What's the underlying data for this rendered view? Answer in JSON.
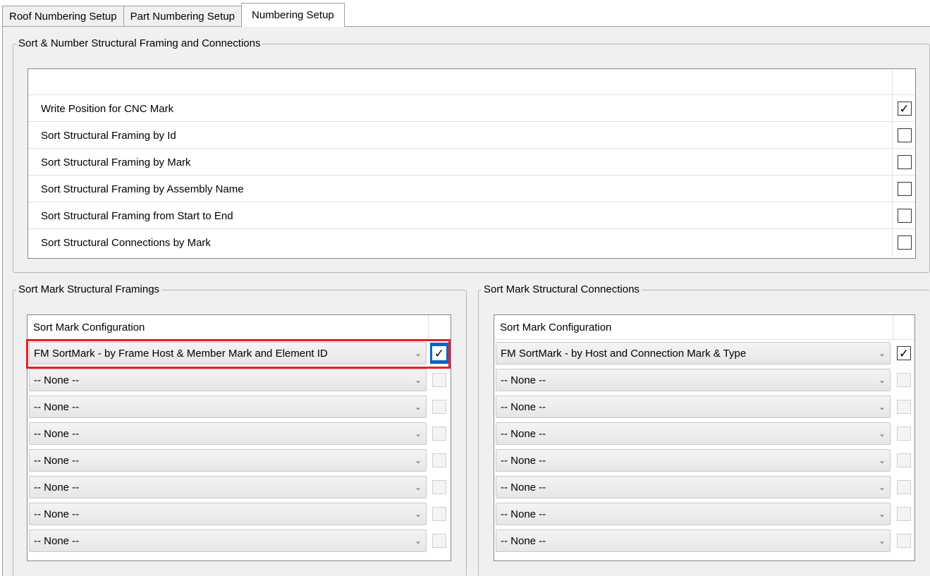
{
  "tabs": [
    "Roof Numbering Setup",
    "Part Numbering Setup",
    "Numbering Setup"
  ],
  "active_tab": 2,
  "sort_number_group": {
    "title": "Sort & Number Structural Framing and Connections",
    "options": [
      {
        "label": "Write Position for CNC Mark",
        "checked": true,
        "mark": "✓"
      },
      {
        "label": "Sort Structural Framing by Id",
        "checked": false,
        "mark": ""
      },
      {
        "label": "Sort Structural Framing by Mark",
        "checked": false,
        "mark": ""
      },
      {
        "label": "Sort Structural Framing by Assembly Name",
        "checked": false,
        "mark": ""
      },
      {
        "label": "Sort Structural Framing from Start to End",
        "checked": false,
        "mark": ""
      },
      {
        "label": "Sort Structural Connections by Mark",
        "checked": false,
        "mark": ""
      }
    ]
  },
  "framings_group": {
    "title": "Sort Mark Structural Framings",
    "column_header": "Sort Mark Configuration",
    "rows": [
      {
        "value": "FM SortMark - by Frame Host & Member Mark and Element ID",
        "checked": true,
        "mark": "✓"
      },
      {
        "value": "-- None --",
        "checked": false,
        "mark": ""
      },
      {
        "value": "-- None --",
        "checked": false,
        "mark": ""
      },
      {
        "value": "-- None --",
        "checked": false,
        "mark": ""
      },
      {
        "value": "-- None --",
        "checked": false,
        "mark": ""
      },
      {
        "value": "-- None --",
        "checked": false,
        "mark": ""
      },
      {
        "value": "-- None --",
        "checked": false,
        "mark": ""
      },
      {
        "value": "-- None --",
        "checked": false,
        "mark": ""
      }
    ]
  },
  "connections_group": {
    "title": "Sort Mark Structural Connections",
    "column_header": "Sort Mark Configuration",
    "rows": [
      {
        "value": "FM SortMark - by Host and Connection Mark & Type",
        "checked": true,
        "mark": "✓"
      },
      {
        "value": "-- None --",
        "checked": false,
        "mark": ""
      },
      {
        "value": "-- None --",
        "checked": false,
        "mark": ""
      },
      {
        "value": "-- None --",
        "checked": false,
        "mark": ""
      },
      {
        "value": "-- None --",
        "checked": false,
        "mark": ""
      },
      {
        "value": "-- None --",
        "checked": false,
        "mark": ""
      },
      {
        "value": "-- None --",
        "checked": false,
        "mark": ""
      },
      {
        "value": "-- None --",
        "checked": false,
        "mark": ""
      }
    ]
  },
  "colors": {
    "highlight": "#e0222a",
    "selected_check": "#0a64c2"
  },
  "icons": {
    "dropdown": "chevron-down-icon",
    "check": "check-icon"
  }
}
